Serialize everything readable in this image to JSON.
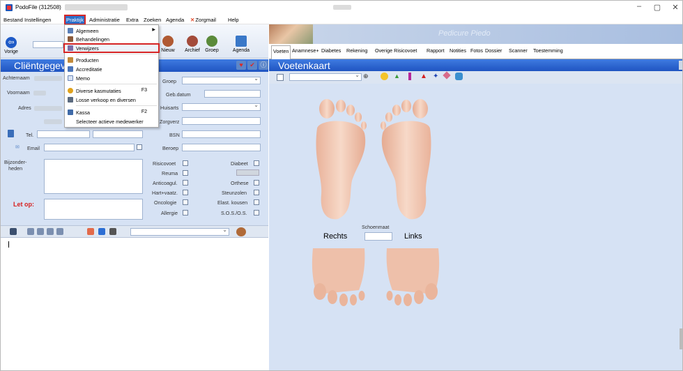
{
  "window": {
    "title": "PodoFile (312508)"
  },
  "menubar": [
    "Bestand",
    "Instellingen",
    "Praktijk",
    "Administratie",
    "Extra",
    "Zoeken",
    "Agenda",
    "Zorgmail",
    "Help"
  ],
  "toolbar": {
    "vorige": "Vorige",
    "nieuw": "Nieuw",
    "archief": "Archief",
    "groep": "Groep",
    "agenda": "Agenda"
  },
  "dropdown": [
    {
      "label": "Algemeen",
      "shortcut": "",
      "submenu": true
    },
    {
      "label": "Behandelingen",
      "shortcut": ""
    },
    {
      "label": "Verwijzers",
      "shortcut": "",
      "highlighted": true
    },
    {
      "label": "Producten",
      "shortcut": ""
    },
    {
      "label": "Accreditatie",
      "shortcut": ""
    },
    {
      "label": "Memo",
      "shortcut": ""
    },
    {
      "label": "Diverse kasmutaties",
      "shortcut": "F3"
    },
    {
      "label": "Losse verkoop en diversen",
      "shortcut": ""
    },
    {
      "label": "Kassa",
      "shortcut": "F2"
    },
    {
      "label": "Selecteer actieve medewerker",
      "shortcut": ""
    }
  ],
  "left": {
    "header": "Cliëntgegev",
    "achternaam": "Achternaam",
    "voornaam": "Voornaam",
    "adres": "Adres",
    "tel": "Tel.",
    "email": "Email",
    "bijzonderheden": "Bijzonder-\nheden",
    "let_op": "Let op:",
    "groep": "Groep",
    "geb_datum": "Geb.datum",
    "huisarts": "Huisarts",
    "zorgverz": "Zorgverz",
    "bsn": "BSN",
    "beroep": "Beroep",
    "left_checks": [
      "Risicovoet",
      "Reuma",
      "Anticoagul.",
      "Hart+vaatz.",
      "Oncologie",
      "Allergie"
    ],
    "right_checks": [
      "Diabeet",
      "Orthese",
      "Steunzolen",
      "Elast. kousen",
      "S.O.S./O.S."
    ]
  },
  "right": {
    "brand": "Pedicure Piedo",
    "tabs": [
      "Voeten",
      "Anamnese+",
      "Diabetes",
      "Rekening",
      "Overige Risicovoet",
      "Rapport",
      "Notities",
      "Fotos",
      "Dossier",
      "Scanner",
      "Toestemming"
    ],
    "header": "Voetenkaart",
    "rechts": "Rechts",
    "links": "Links",
    "schoenmaat": "Schoenmaat"
  },
  "colors": {
    "accent": "#1f54c1",
    "highlight": "#d72828",
    "panel": "#d6e2f4"
  }
}
